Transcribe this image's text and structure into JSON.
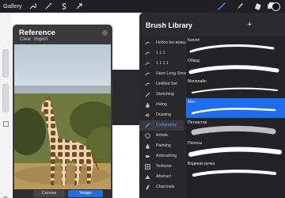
{
  "topbar": {
    "gallery_label": "Gallery",
    "left_icons": [
      "wrench-icon",
      "magic-wand-icon",
      "selection-s-icon",
      "transform-arrow-icon"
    ],
    "right_icons": [
      "brush-icon",
      "smudge-icon",
      "eraser-icon",
      "layers-icon"
    ],
    "accent_color": "#2f7bff"
  },
  "reference": {
    "title": "Reference",
    "clear_label": "Clear",
    "import_label": "Import",
    "tabs": [
      {
        "label": "Canvas",
        "active": false
      },
      {
        "label": "Image",
        "active": true
      }
    ]
  },
  "brush_library": {
    "title": "Brush Library",
    "add_label": "+",
    "categories": [
      {
        "label": "Нобсо lou воиьаеmм",
        "icon": "stroke-icon"
      },
      {
        "label": "1 1 1",
        "icon": "stroke-icon"
      },
      {
        "label": "1 1 1 1",
        "icon": "stroke-icon"
      },
      {
        "label": "Hazo Long Smudge",
        "icon": "stroke-icon"
      },
      {
        "label": "Untitled Set",
        "icon": "stroke-icon"
      },
      {
        "label": "Sketching",
        "icon": "pencil-icon"
      },
      {
        "label": "Inking",
        "icon": "ink-drop-icon"
      },
      {
        "label": "Drawing",
        "icon": "swirl-icon"
      },
      {
        "label": "Calligraphy",
        "icon": "calligraphy-icon",
        "active": true
      },
      {
        "label": "Artistic",
        "icon": "palette-icon"
      },
      {
        "label": "Painting",
        "icon": "paint-drop-icon"
      },
      {
        "label": "Airbrushing",
        "icon": "airbrush-icon"
      },
      {
        "label": "Textures",
        "icon": "texture-icon"
      },
      {
        "label": "Abstract",
        "icon": "triangle-icon"
      },
      {
        "label": "Charcoals",
        "icon": "charcoal-icon"
      }
    ],
    "brushes": [
      {
        "name": "Капля!",
        "selected": false
      },
      {
        "name": "Обвод",
        "selected": false
      },
      {
        "name": "Монолайн",
        "selected": false
      },
      {
        "name": "Мел",
        "selected": true
      },
      {
        "name": "Пятнистая",
        "selected": false
      },
      {
        "name": "Полосы",
        "selected": false
      },
      {
        "name": "Водяная ручка",
        "selected": false
      }
    ]
  }
}
